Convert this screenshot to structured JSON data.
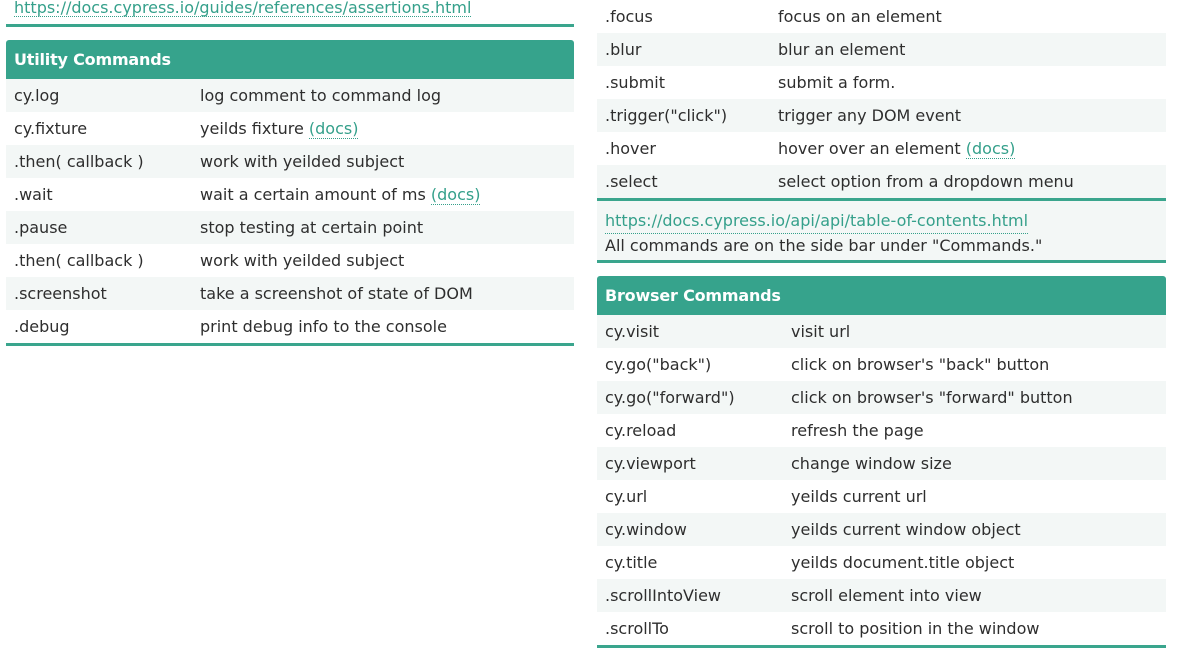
{
  "left": {
    "top_url": "https://docs.cypress.io/guides/references/assertions.html",
    "utility": {
      "title": "Utility Commands",
      "rows": [
        {
          "cmd": "cy.log",
          "desc": "log comment to command log",
          "docs": ""
        },
        {
          "cmd": "cy.fixture",
          "desc": "yeilds fixture",
          "docs": "(docs)"
        },
        {
          "cmd": ".then( callback )",
          "desc": "work with yeilded subject",
          "docs": ""
        },
        {
          "cmd": ".wait",
          "desc": "wait a certain amount of ms",
          "docs": "(docs)"
        },
        {
          "cmd": ".pause",
          "desc": "stop testing at certain point",
          "docs": ""
        },
        {
          "cmd": ".then( callback )",
          "desc": "work with yeilded subject",
          "docs": ""
        },
        {
          "cmd": ".screenshot",
          "desc": "take a screenshot of state of DOM",
          "docs": ""
        },
        {
          "cmd": ".debug",
          "desc": "print debug info to the console",
          "docs": ""
        }
      ]
    }
  },
  "right": {
    "top_rows": [
      {
        "cmd": ".focus",
        "desc": "focus on an element",
        "docs": ""
      },
      {
        "cmd": ".blur",
        "desc": "blur an element",
        "docs": ""
      },
      {
        "cmd": ".submit",
        "desc": "submit a form.",
        "docs": ""
      },
      {
        "cmd": ".trigger(\"click\")",
        "desc": "trigger any DOM event",
        "docs": ""
      },
      {
        "cmd": ".hover",
        "desc": "hover over an element",
        "docs": "(docs)"
      },
      {
        "cmd": ".select",
        "desc": "select option from a dropdown menu",
        "docs": ""
      }
    ],
    "note": {
      "url": "https://docs.cypress.io/api/api/table-of-contents.html",
      "text": "All commands are on the side bar under \"Commands.\""
    },
    "browser": {
      "title": "Browser Commands",
      "rows": [
        {
          "cmd": "cy.visit",
          "desc": "visit url",
          "docs": ""
        },
        {
          "cmd": "cy.go(\"back\")",
          "desc": "click on browser's \"back\" button",
          "docs": ""
        },
        {
          "cmd": "cy.go(\"forward\")",
          "desc": "click on browser's \"forward\" button",
          "docs": ""
        },
        {
          "cmd": "cy.reload",
          "desc": "refresh the page",
          "docs": ""
        },
        {
          "cmd": "cy.viewport",
          "desc": "change window size",
          "docs": ""
        },
        {
          "cmd": "cy.url",
          "desc": "yeilds current url",
          "docs": ""
        },
        {
          "cmd": "cy.window",
          "desc": "yeilds current window object",
          "docs": ""
        },
        {
          "cmd": "cy.title",
          "desc": "yeilds document.title object",
          "docs": ""
        },
        {
          "cmd": ".scrollIntoView",
          "desc": "scroll element into view",
          "docs": ""
        },
        {
          "cmd": ".scrollTo",
          "desc": "scroll to position in the window",
          "docs": ""
        }
      ]
    }
  }
}
